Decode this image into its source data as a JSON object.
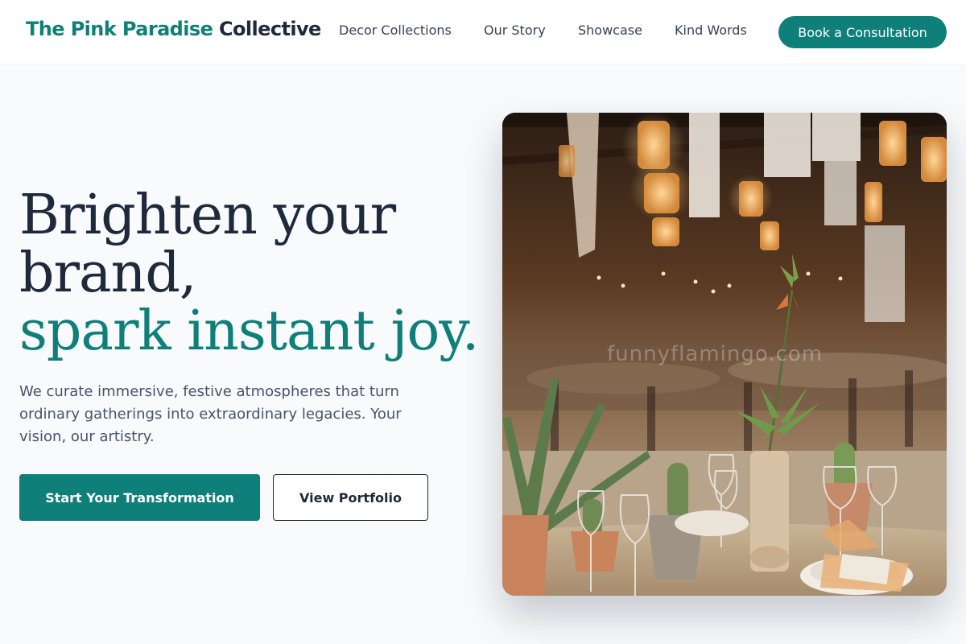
{
  "header": {
    "brand": {
      "part1": "The Pink Paradise",
      "part2": "Collective"
    },
    "nav": [
      {
        "label": "Decor Collections"
      },
      {
        "label": "Our Story"
      },
      {
        "label": "Showcase"
      },
      {
        "label": "Kind Words"
      }
    ],
    "cta_label": "Book a Consultation"
  },
  "hero": {
    "headline_line1": "Brighten your",
    "headline_line2": "brand,",
    "headline_line3": "spark instant joy.",
    "description": "We curate immersive, festive atmospheres that turn ordinary gatherings into extraordinary legacies. Your vision, our artistry.",
    "primary_button": "Start Your Transformation",
    "secondary_button": "View Portfolio",
    "image_watermark": "funnyflamingo.com"
  },
  "colors": {
    "accent": "#0f7f7a",
    "text_dark": "#1e293b",
    "background": "#f8fafc"
  }
}
